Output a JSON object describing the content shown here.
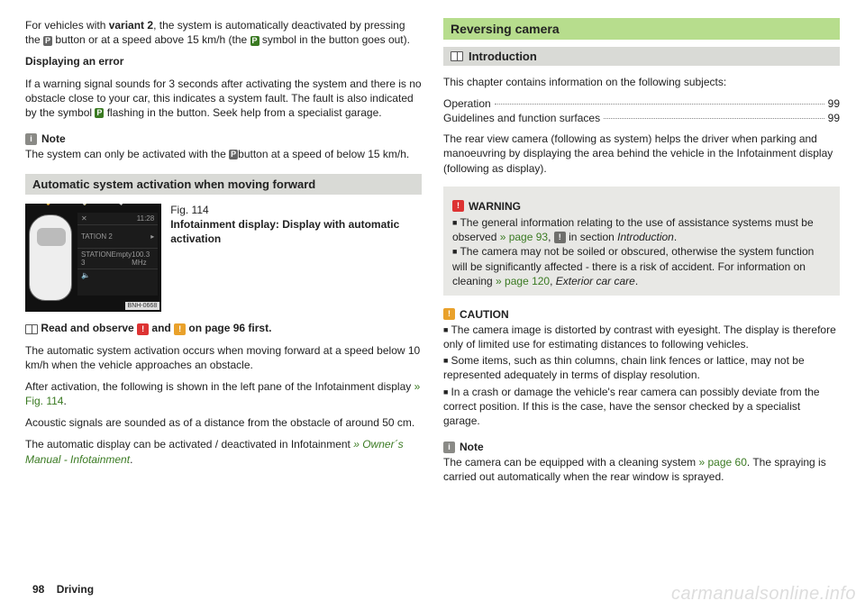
{
  "left": {
    "p1a": "For vehicles with ",
    "p1b": "variant 2",
    "p1c": ", the system is automatically deactivated by pressing the ",
    "p1d": " button or at a speed above 15 km/h (the ",
    "p1e": " symbol in the button goes out).",
    "err_head": "Displaying an error",
    "err_body_a": "If a warning signal sounds for 3 seconds after activating the system and there is no obstacle close to your car, this indicates a system fault. The fault is also indicated by the symbol ",
    "err_body_b": " flashing in the button. Seek help from a specialist garage.",
    "note_label": "Note",
    "note_body_a": "The system can only be activated with the ",
    "note_body_b": "button at a speed of below 15 km/h.",
    "bar_title": "Automatic system activation when moving forward",
    "fig_num": "Fig. 114",
    "fig_caption": "Infotainment display: Display with automatic activation",
    "panel": {
      "time": "11:28",
      "s2": "TATION 2",
      "s3": "STATION 3",
      "empty": "Empty",
      "freq": "100.3 MHz"
    },
    "fig_label": "BNH-0668",
    "read_a": "Read and observe ",
    "read_b": " and ",
    "read_c": " on page 96 first.",
    "p2": "The automatic system activation occurs when moving forward at a speed below 10 km/h when the vehicle approaches an obstacle.",
    "p3a": "After activation, the following is shown in the left pane of the Infotainment display ",
    "p3b": "» Fig. 114",
    "p3c": ".",
    "p4": "Acoustic signals are sounded as of a distance from the obstacle of around 50 cm.",
    "p5a": "The automatic display can be activated / deactivated in Infotainment ",
    "p5b": "» Owner´s Manual - Infotainment",
    "p5c": "."
  },
  "right": {
    "green_title": "Reversing camera",
    "sub_title": "Introduction",
    "intro": "This chapter contains information on the following subjects:",
    "toc": [
      {
        "label": "Operation",
        "page": "99"
      },
      {
        "label": "Guidelines and function surfaces",
        "page": "99"
      }
    ],
    "desc": "The rear view camera (following as system) helps the driver when parking and manoeuvring by displaying the area behind the vehicle in the Infotainment display (following as display).",
    "warn_label": "WARNING",
    "warn1a": "The general information relating to the use of assistance systems must be observed ",
    "warn1b": "» page 93",
    "warn1c": ", ",
    "warn1d": " in section ",
    "warn1e": "Introduction",
    "warn1f": ".",
    "warn2a": "The camera may not be soiled or obscured, otherwise the system function will be significantly affected - there is a risk of accident. For information on cleaning ",
    "warn2b": "» page 120",
    "warn2c": ", ",
    "warn2d": "Exterior car care",
    "warn2e": ".",
    "caution_label": "CAUTION",
    "c1": "The camera image is distorted by contrast with eyesight. The display is therefore only of limited use for estimating distances to following vehicles.",
    "c2": "Some items, such as thin columns, chain link fences or lattice, may not be represented adequately in terms of display resolution.",
    "c3": "In a crash or damage the vehicle's rear camera can possibly deviate from the correct position. If this is the case, have the sensor checked by a specialist garage.",
    "note_label": "Note",
    "note_a": "The camera can be equipped with a cleaning system ",
    "note_b": "» page 60",
    "note_c": ". The spraying is carried out automatically when the rear window is sprayed."
  },
  "footer": {
    "page": "98",
    "section": "Driving"
  },
  "watermark": "carmanualsonline.info"
}
